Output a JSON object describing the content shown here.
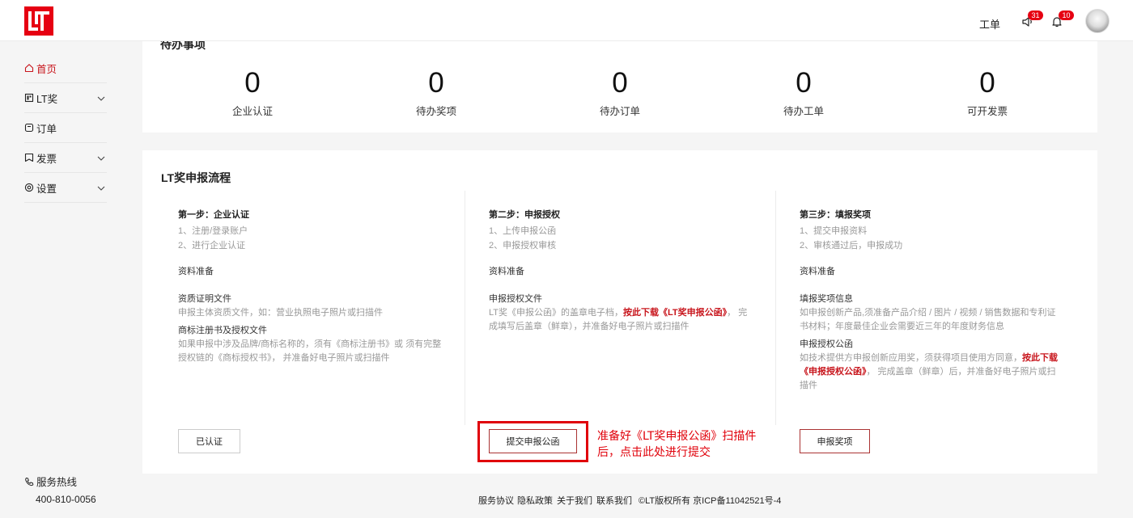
{
  "header": {
    "logo_alt": "LT",
    "ticket_label": "工单",
    "announce_badge": "31",
    "notify_badge": "10"
  },
  "sidebar": {
    "items": [
      {
        "label": "首页",
        "icon": "home-icon",
        "active": true
      },
      {
        "label": "LT奖",
        "icon": "award-icon",
        "expandable": true
      },
      {
        "label": "订单",
        "icon": "order-icon"
      },
      {
        "label": "发票",
        "icon": "invoice-icon",
        "expandable": true
      },
      {
        "label": "设置",
        "icon": "settings-icon",
        "expandable": true
      }
    ],
    "hotline_label": "服务热线",
    "hotline_number": "400-810-0056"
  },
  "todo": {
    "title": "待办事项",
    "stats": [
      {
        "value": "0",
        "label": "企业认证"
      },
      {
        "value": "0",
        "label": "待办奖项"
      },
      {
        "value": "0",
        "label": "待办订单"
      },
      {
        "value": "0",
        "label": "待办工单"
      },
      {
        "value": "0",
        "label": "可开发票"
      }
    ]
  },
  "process": {
    "title": "LT奖申报流程",
    "steps": [
      {
        "title": "第一步：企业认证",
        "lines": [
          "1、注册/登录账户",
          "2、进行企业认证"
        ],
        "prep": "资料准备",
        "docs": [
          {
            "title": "资质证明文件",
            "desc": "申报主体资质文件，如：营业执照电子照片或扫描件"
          },
          {
            "title": "商标注册书及授权文件",
            "desc": "如果申报中涉及品牌/商标名称的，须有《商标注册书》或 须有完整授权链的《商标授权书》， 并准备好电子照片或扫描件"
          }
        ],
        "button": "已认证"
      },
      {
        "title": "第二步：申报授权",
        "lines": [
          "1、上传申报公函",
          "2、申报授权审核"
        ],
        "prep": "资料准备",
        "docs": [
          {
            "title": "申报授权文件",
            "desc_pre": "LT奖《申报公函》的盖章电子档，",
            "desc_link": "按此下载《LT奖申报公函》",
            "desc_post": "， 完成填写后盖章（鲜章），并准备好电子照片或扫描件"
          }
        ],
        "button": "提交申报公函"
      },
      {
        "title": "第三步：填报奖项",
        "lines": [
          "1、提交申报资料",
          "2、审核通过后，申报成功"
        ],
        "prep": "资料准备",
        "docs": [
          {
            "title": "填报奖项信息",
            "desc": "如申报创新产品,须准备产品介绍 / 图片 / 视频 / 销售数据和专利证书材料；年度最佳企业会需要近三年的年度财务信息"
          },
          {
            "title": "申报授权公函",
            "desc_pre": "如技术提供方申报创新应用奖，须获得项目使用方同意，",
            "desc_link": "按此下载《申报授权公函》",
            "desc_post": "， 完成盖章（鲜章）后，并准备好电子照片或扫描件"
          }
        ],
        "button": "申报奖项"
      }
    ]
  },
  "annotation": {
    "line1": "准备好《LT奖申报公函》扫描件",
    "line2": "后，点击此处进行提交"
  },
  "footer": {
    "links": [
      "服务协议",
      "隐私政策",
      "关于我们",
      "联系我们"
    ],
    "copyright": "©LT版权所有 京ICP备11042521号-4"
  },
  "colors": {
    "brand_red": "#e60012",
    "link_red": "#c8161d",
    "annotation_red": "#e0000a"
  }
}
